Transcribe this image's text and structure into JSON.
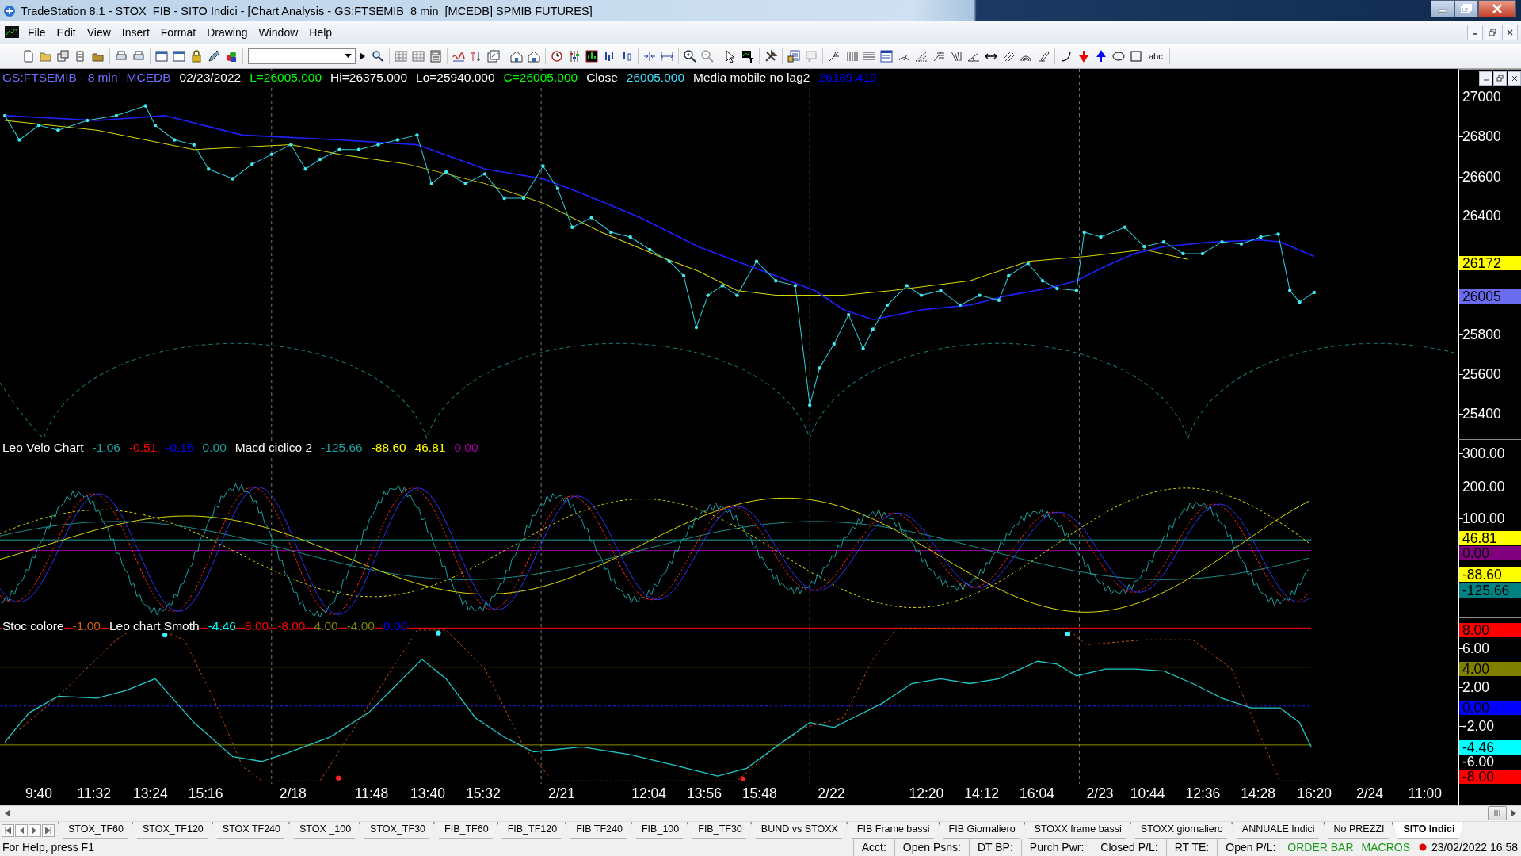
{
  "window": {
    "title": "TradeStation 8.1 - STOX_FIB - SITO Indici - [Chart Analysis - GS:FTSEMIB  8 min  [MCEDB] SPMIB FUTURES]"
  },
  "menu": [
    "File",
    "Edit",
    "View",
    "Insert",
    "Format",
    "Drawing",
    "Window",
    "Help"
  ],
  "toolbar": {
    "text_tool": "abc"
  },
  "chart": {
    "price_pane": {
      "legend": [
        {
          "text": "GS:FTSEMIB - 8 min",
          "color": "#6f6fff"
        },
        {
          "text": "MCEDB",
          "color": "#6f6fff"
        },
        {
          "text": "02/23/2022",
          "color": "#ffffff"
        },
        {
          "text": "L=26005.000",
          "color": "#00ff00"
        },
        {
          "text": "Hi=26375.000",
          "color": "#ffffff"
        },
        {
          "text": "Lo=25940.000",
          "color": "#ffffff"
        },
        {
          "text": "C=26005.000",
          "color": "#00ff00"
        },
        {
          "text": "Close",
          "color": "#ffffff"
        },
        {
          "text": "26005.000",
          "color": "#40e0ff"
        },
        {
          "text": "Media mobile no lag2",
          "color": "#ffffff"
        },
        {
          "text": "26189.419",
          "color": "#0000ff"
        }
      ],
      "axis_labels": [
        "27000",
        "26800",
        "26600",
        "26400",
        "25800",
        "25600",
        "25400"
      ],
      "markers": [
        {
          "text": "26172",
          "color": "#ffff00"
        },
        {
          "text": "26005",
          "color": "#6b6bf0"
        }
      ]
    },
    "indicator_pane": {
      "legend": [
        {
          "text": "Leo Velo Chart",
          "color": "#ffffff"
        },
        {
          "text": "-1.06",
          "color": "#1aa0a0"
        },
        {
          "text": "-0.51",
          "color": "#ff0000"
        },
        {
          "text": "-0.16",
          "color": "#0000ff"
        },
        {
          "text": "0.00",
          "color": "#1aa0a0"
        },
        {
          "text": "Macd ciclico 2",
          "color": "#ffffff"
        },
        {
          "text": "-125.66",
          "color": "#1aa0a0"
        },
        {
          "text": "-88.60",
          "color": "#ffff00"
        },
        {
          "text": "46.81",
          "color": "#ffff00"
        },
        {
          "text": "0.00",
          "color": "#a000a0"
        }
      ],
      "axis_labels": [
        "300.00",
        "200.00",
        "100.00"
      ],
      "markers": [
        {
          "text": "46.81",
          "color": "#ffff00"
        },
        {
          "text": "0.00",
          "color": "#800080"
        },
        {
          "text": "-88.60",
          "color": "#ffff00"
        },
        {
          "text": "-125.66",
          "color": "#008080"
        }
      ]
    },
    "stochastic_pane": {
      "legend": [
        {
          "text": "Stoc colore",
          "color": "#ffffff"
        },
        {
          "text": "-1.00",
          "color": "#d06010"
        },
        {
          "text": "Leo chart Smoth",
          "color": "#ffffff"
        },
        {
          "text": "-4.46",
          "color": "#00ffff"
        },
        {
          "text": "8.00",
          "color": "#ff0000"
        },
        {
          "text": "-8.00",
          "color": "#ff0000"
        },
        {
          "text": "4.00",
          "color": "#808000"
        },
        {
          "text": "-4.00",
          "color": "#808000"
        },
        {
          "text": "0.00",
          "color": "#0000ff"
        }
      ],
      "axis_labels": [
        "6.00",
        "2.00",
        "-2.00",
        "-6.00"
      ],
      "markers": [
        {
          "text": "8.00",
          "color": "#ff0000"
        },
        {
          "text": "4.00",
          "color": "#808000"
        },
        {
          "text": "0.00",
          "color": "#0000ff"
        },
        {
          "text": "-4.46",
          "color": "#00ffff"
        },
        {
          "text": "-8.00",
          "color": "#ff0000"
        }
      ]
    },
    "x_axis": [
      "9:40",
      "11:32",
      "13:24",
      "15:16",
      "2/18",
      "11:48",
      "13:40",
      "15:32",
      "2/21",
      "12:04",
      "13:56",
      "15:48",
      "2/22",
      "12:20",
      "14:12",
      "16:04",
      "2/23",
      "10:44",
      "12:36",
      "14:28",
      "16:20",
      "2/24",
      "11:00"
    ]
  },
  "tabs": [
    {
      "label": "STOX_TF60",
      "selected": false
    },
    {
      "label": "STOX_TF120",
      "selected": false
    },
    {
      "label": "STOX TF240",
      "selected": false
    },
    {
      "label": "STOX _100",
      "selected": false
    },
    {
      "label": "STOX_TF30",
      "selected": false
    },
    {
      "label": "FIB_TF60",
      "selected": false
    },
    {
      "label": "FIB_TF120",
      "selected": false
    },
    {
      "label": "FIB TF240",
      "selected": false
    },
    {
      "label": "FIB_100",
      "selected": false
    },
    {
      "label": "FIB_TF30",
      "selected": false
    },
    {
      "label": "BUND vs STOXX",
      "selected": false
    },
    {
      "label": "FIB Frame bassi",
      "selected": false
    },
    {
      "label": "FIB Giornaliero",
      "selected": false
    },
    {
      "label": "STOXX frame bassi",
      "selected": false
    },
    {
      "label": "STOXX giornaliero",
      "selected": false
    },
    {
      "label": "ANNUALE Indici",
      "selected": false
    },
    {
      "label": "No PREZZI",
      "selected": false
    },
    {
      "label": "SITO Indici",
      "selected": true
    }
  ],
  "status_bar": {
    "help": "For Help, press F1",
    "fields": [
      "Acct:",
      "Open Psns:",
      "DT BP:",
      "Purch Pwr:",
      "Closed P/L:",
      "RT TE:",
      "Open P/L:"
    ],
    "order_bar": "ORDER BAR",
    "macros": "MACROS",
    "datetime": "23/02/2022 16:58"
  }
}
